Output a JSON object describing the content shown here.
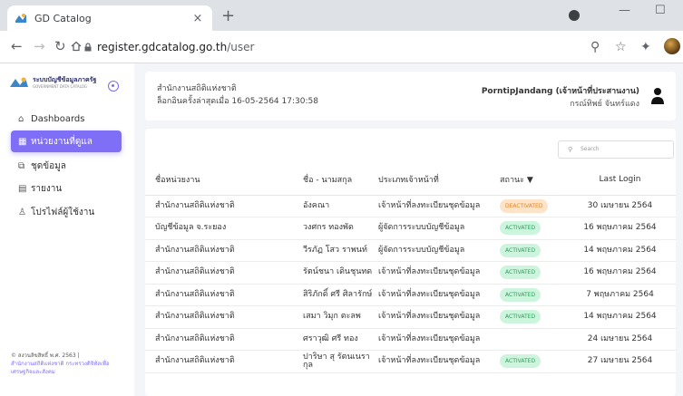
{
  "browser": {
    "tab_title": "GD Catalog",
    "tab_close": "×",
    "new_tab": "+",
    "url_host": "register.gdcatalog.go.th",
    "url_path": "/user"
  },
  "sidebar": {
    "logo_line1": "ระบบบัญชีข้อมูลภาครัฐ",
    "logo_line2": "GOVERNMENT DATA CATALOG",
    "items": [
      {
        "label": "Dashboards",
        "icon": "home-icon"
      },
      {
        "label": "หน่วยงานที่ดูแล",
        "icon": "grid-icon"
      },
      {
        "label": "ชุดข้อมูล",
        "icon": "dataset-icon"
      },
      {
        "label": "รายงาน",
        "icon": "report-icon"
      },
      {
        "label": "โปรไฟล์ผู้ใช้งาน",
        "icon": "user-icon"
      }
    ],
    "footer_copyright": "© สงวนลิขสิทธิ์ พ.ศ. 2563 |",
    "footer_org": "สำนักงานสถิติแห่งชาติ กระทรวงดิจิทัลเพื่อเศรษฐกิจและสังคม"
  },
  "header": {
    "org": "สำนักงานสถิติแห่งชาติ",
    "last_login": "ล็อกอินครั้งล่าสุดเมื่อ 16-05-2564 17:30:58",
    "username": "PorntipJandang (เจ้าหน้าที่ประสานงาน)",
    "realname": "กรณ์ทิพย์ จันทร์แดง"
  },
  "search": {
    "placeholder": "Search"
  },
  "table": {
    "headers": [
      "ชื่อหน่วยงาน",
      "ชื่อ - นามสกุล",
      "ประเภทเจ้าหน้าที่",
      "สถานะ ▼",
      "Last Login"
    ],
    "rows": [
      {
        "org": "สำนักงานสถิติแห่งชาติ",
        "name": "อังคณา",
        "type": "เจ้าหน้าที่ลงทะเบียนชุดข้อมูล",
        "status": "DEACTIVATED",
        "login": "30 เมษายน 2564"
      },
      {
        "org": "บัญชีข้อมูล จ.ระยอง",
        "name": "วงศกร ทองพัด",
        "type": "ผู้จัดการระบบบัญชีข้อมูล",
        "status": "ACTIVATED",
        "login": "16 พฤษภาคม 2564"
      },
      {
        "org": "สำนักงานสถิติแห่งชาติ",
        "name": "วีรภัฏ โสว ราพนท์",
        "type": "ผู้จัดการระบบบัญชีข้อมูล",
        "status": "ACTIVATED",
        "login": "14 พฤษภาคม 2564"
      },
      {
        "org": "สำนักงานสถิติแห่งชาติ",
        "name": "รัตน์ชนา เดินชุนทด",
        "type": "เจ้าหน้าที่ลงทะเบียนชุดข้อมูล",
        "status": "ACTIVATED",
        "login": "16 พฤษภาคม 2564"
      },
      {
        "org": "สำนักงานสถิติแห่งชาติ",
        "name": "สิริภักดิ์ ศรี ศิลารักษ์",
        "type": "เจ้าหน้าที่ลงทะเบียนชุดข้อมูล",
        "status": "ACTIVATED",
        "login": "7 พฤษภาคม 2564"
      },
      {
        "org": "สำนักงานสถิติแห่งชาติ",
        "name": "เสมา วิมุก ตะลพ",
        "type": "เจ้าหน้าที่ลงทะเบียนชุดข้อมูล",
        "status": "ACTIVATED",
        "login": "14 พฤษภาคม 2564"
      },
      {
        "org": "สำนักงานสถิติแห่งชาติ",
        "name": "ศราวุฒิ ศรี ทอง",
        "type": "เจ้าหน้าที่ลงทะเบียนชุดข้อมูล",
        "status": "",
        "login": "24 เมษายน 2564"
      },
      {
        "org": "สำนักงานสถิติแห่งชาติ",
        "name": "ปาริษา สุ รัตนเนรา กุล",
        "type": "เจ้าหน้าที่ลงทะเบียนชุดข้อมูล",
        "status": "ACTIVATED",
        "login": "27 เมษายน 2564"
      }
    ]
  },
  "colors": {
    "accent": "#7f6ff7",
    "activated_bg": "#cdf5dd",
    "deactivated_bg": "#fde3c8"
  }
}
